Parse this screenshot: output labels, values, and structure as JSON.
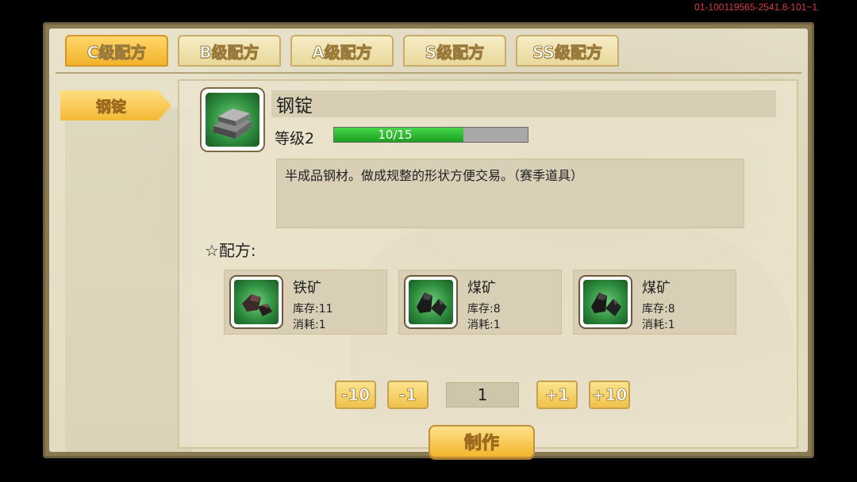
{
  "version_text": "01-100119565-2541.8-101~1",
  "tabs": [
    {
      "label": "C级配方",
      "active": true
    },
    {
      "label": "B级配方",
      "active": false
    },
    {
      "label": "A级配方",
      "active": false
    },
    {
      "label": "S级配方",
      "active": false
    },
    {
      "label": "SS级配方",
      "active": false
    }
  ],
  "sidebar": {
    "items": [
      {
        "label": "钢锭",
        "selected": true
      }
    ]
  },
  "item": {
    "name": "钢锭",
    "icon": "steel-ingot-icon",
    "level_label": "等级2",
    "progress_text": "10/15",
    "progress_value": 10,
    "progress_max": 15,
    "description": "半成品钢材。做成规整的形状方便交易。（赛季道具）"
  },
  "recipe": {
    "title": "☆配方:",
    "ingredients": [
      {
        "name": "铁矿",
        "stock": "库存:11",
        "cost": "消耗:1",
        "icon": "iron-ore-icon"
      },
      {
        "name": "煤矿",
        "stock": "库存:8",
        "cost": "消耗:1",
        "icon": "coal-ore-icon"
      },
      {
        "name": "煤矿",
        "stock": "库存:8",
        "cost": "消耗:1",
        "icon": "coal-ore-icon"
      }
    ]
  },
  "quantity": {
    "minus10": "-10",
    "minus1": "-1",
    "value": "1",
    "plus1": "+1",
    "plus10": "+10"
  },
  "craft_label": "制作",
  "colors": {
    "accent": "#f3b32c",
    "progress": "#1aa01f",
    "panel": "#e9e2cb"
  }
}
